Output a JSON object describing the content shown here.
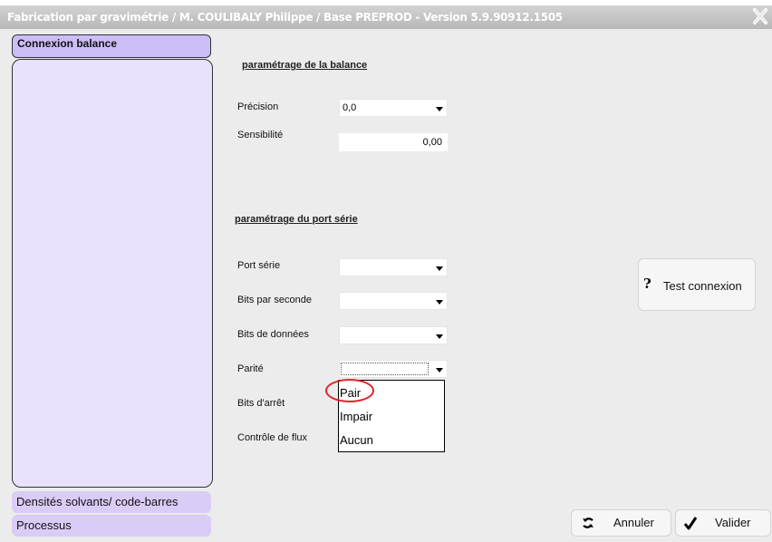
{
  "window": {
    "title": "Fabrication par gravimétrie / M. COULIBALY Philippe / Base PREPROD - Version 5.9.90912.1505"
  },
  "sidebar": {
    "items": [
      {
        "label": "Connexion balance",
        "active": true
      },
      {
        "label": "Densités solvants/ code-barres",
        "active": false
      },
      {
        "label": "Processus",
        "active": false
      }
    ]
  },
  "scale_section": {
    "heading": "paramétrage de la balance",
    "precision": {
      "label": "Précision",
      "value": "0,0"
    },
    "sensitivity": {
      "label": "Sensibilité",
      "value": "0,00"
    }
  },
  "serial_section": {
    "heading": "paramétrage du port série",
    "port": {
      "label": "Port série",
      "value": ""
    },
    "baud": {
      "label": "Bits par seconde",
      "value": ""
    },
    "data_bits": {
      "label": "Bits de données",
      "value": ""
    },
    "parity": {
      "label": "Parité",
      "value": "",
      "options": [
        "Pair",
        "Impair",
        "Aucun"
      ]
    },
    "stop_bits": {
      "label": "Bits d'arrêt"
    },
    "flow_control": {
      "label": "Contrôle de flux"
    }
  },
  "buttons": {
    "test": "Test connexion",
    "cancel": "Annuler",
    "validate": "Valider"
  },
  "colors": {
    "sidebar_item": "#d9ccf6",
    "sidebar_panel": "#e9e0fc",
    "highlight_ring": "#e0242a"
  }
}
